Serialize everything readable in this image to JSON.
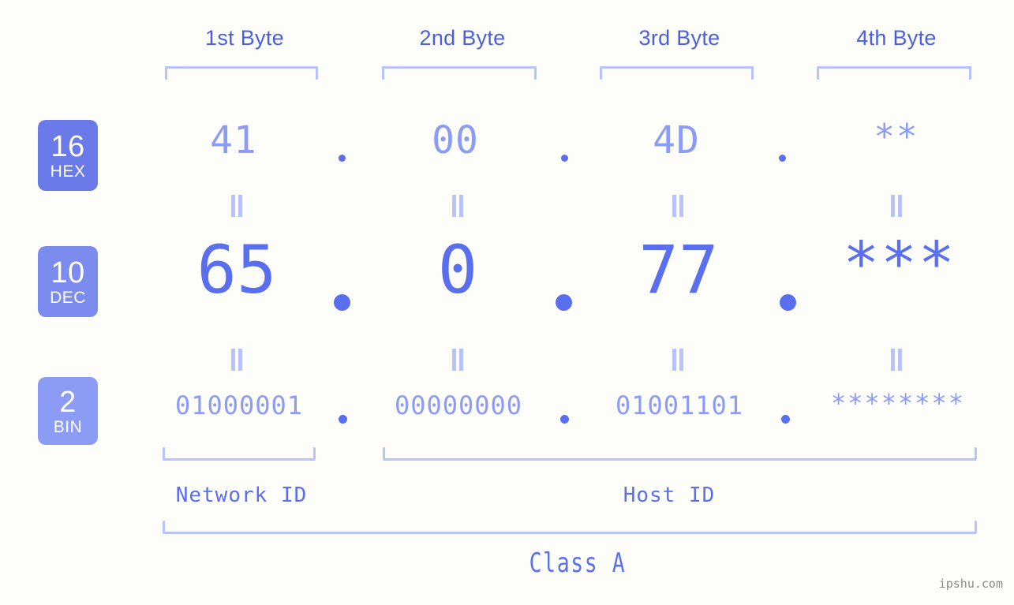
{
  "background_color": "#fdfdfa",
  "accent_strong": "#5a6ff0",
  "accent_mid": "#8c9cf5",
  "accent_light": "#b8c2fb",
  "header": {
    "byte_labels": [
      {
        "label": "1st Byte"
      },
      {
        "label": "2nd Byte"
      },
      {
        "label": "3rd Byte"
      },
      {
        "label": "4th Byte"
      }
    ]
  },
  "bases": [
    {
      "number": "16",
      "name": "HEX",
      "color": "#6a7ae8"
    },
    {
      "number": "10",
      "name": "DEC",
      "color": "#7b8bee"
    },
    {
      "number": "2",
      "name": "BIN",
      "color": "#8c9cf5"
    }
  ],
  "rows": {
    "hex": {
      "base_number": "16",
      "base_name": "HEX",
      "values": [
        "41",
        "00",
        "4D",
        "**"
      ],
      "separator": "."
    },
    "dec": {
      "base_number": "10",
      "base_name": "DEC",
      "values": [
        "65",
        "0",
        "77",
        "***"
      ],
      "separator": "."
    },
    "bin": {
      "base_number": "2",
      "base_name": "BIN",
      "values": [
        "01000001",
        "00000000",
        "01001101",
        "********"
      ],
      "separator": "."
    }
  },
  "equivalence_marks": {
    "glyph": "||",
    "count_per_row": 4,
    "rows": 2
  },
  "footer": {
    "network_id_label": "Network ID",
    "host_id_label": "Host ID",
    "class_label": "Class A"
  },
  "watermark": "ipshu.com"
}
